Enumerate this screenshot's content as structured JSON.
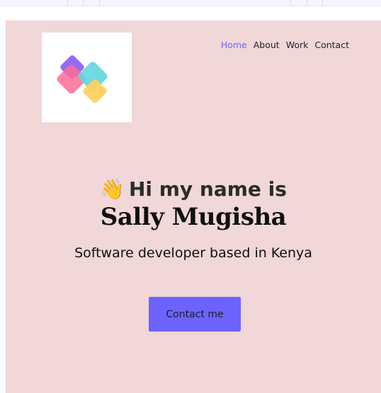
{
  "nav": {
    "items": [
      {
        "label": "Home",
        "active": true
      },
      {
        "label": "About",
        "active": false
      },
      {
        "label": "Work",
        "active": false
      },
      {
        "label": "Contact",
        "active": false
      }
    ]
  },
  "hero": {
    "wave_emoji": "👋",
    "greeting": "Hi my name is",
    "name": "Sally Mugisha",
    "tagline": "Software developer based in Kenya",
    "cta_label": "Contact me"
  },
  "colors": {
    "page_background": "#f1d7d7",
    "accent": "#6c63ff",
    "logo_background": "#ffffff"
  },
  "icons": {
    "logo": "colorful-diamond-logo-icon",
    "wave": "waving-hand-icon"
  }
}
